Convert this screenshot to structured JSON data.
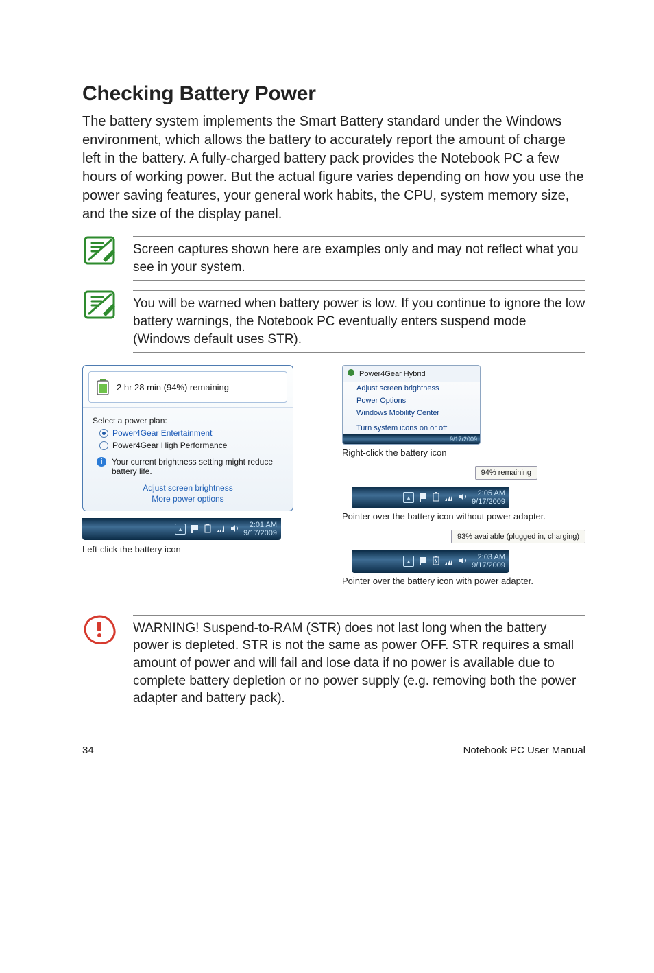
{
  "section_title": "Checking Battery Power",
  "intro_paragraph": "The battery system implements the Smart Battery standard under the Windows environment, which allows the battery to accurately report the amount of charge left in the battery. A fully-charged battery pack provides the Notebook PC a few hours of working power. But the actual figure varies depending on how you use the power saving features, your general work habits, the CPU, system memory size, and the size of the display panel.",
  "note1": "Screen captures shown here are examples only and may not reflect what you see in your system.",
  "note2": "You will be warned when battery power is low. If you continue to ignore the low battery warnings, the Notebook PC eventually enters suspend mode (Windows default uses STR).",
  "warning_text": "WARNING!  Suspend-to-RAM (STR) does not last long when the battery power is depleted. STR is not the same as power OFF. STR requires a small amount of power and will fail and lose data if no power is available due to complete battery depletion or no power supply (e.g. removing both the power adapter and battery pack).",
  "left_popup": {
    "remaining": "2 hr 28 min (94%) remaining",
    "plan_label": "Select a power plan:",
    "plan_a": "Power4Gear Entertainment",
    "plan_b": "Power4Gear High Performance",
    "brightness_tip": "Your current brightness setting might reduce battery life.",
    "link_a": "Adjust screen brightness",
    "link_b": "More power options",
    "tray_time": "2:01 AM",
    "tray_date": "9/17/2009",
    "caption": "Left-click the battery icon"
  },
  "context_menu": {
    "title": "Power4Gear Hybrid",
    "item1": "Adjust screen brightness",
    "item2": "Power Options",
    "item3": "Windows Mobility Center",
    "item4": "Turn system icons on or off",
    "tray_date": "9/17/2009",
    "caption": "Right-click the battery icon"
  },
  "tooltip_1": {
    "text": "94% remaining",
    "tray_time": "2:05 AM",
    "tray_date": "9/17/2009",
    "caption": "Pointer over the battery icon without power adapter."
  },
  "tooltip_2": {
    "text": "93% available (plugged in, charging)",
    "tray_time": "2:03 AM",
    "tray_date": "9/17/2009",
    "caption": "Pointer over the battery icon with power adapter."
  },
  "footer": {
    "page": "34",
    "book": "Notebook PC User Manual"
  }
}
